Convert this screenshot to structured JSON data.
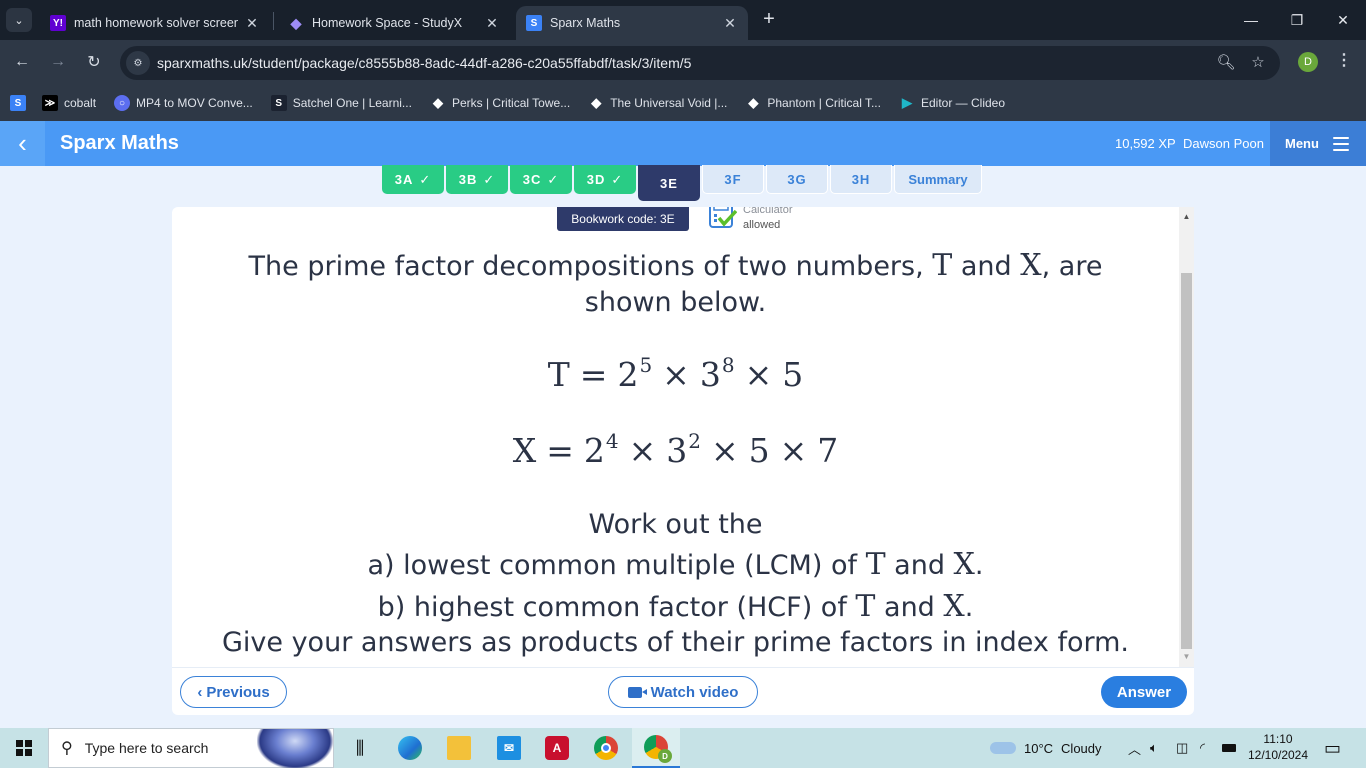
{
  "browser": {
    "tabs": [
      {
        "title": "math homework solver screen s",
        "favicon": "Y!",
        "favicon_color": "#6001d2",
        "active": false
      },
      {
        "title": "Homework Space - StudyX",
        "favicon": "◆",
        "favicon_color": "#7d6df0",
        "active": false
      },
      {
        "title": "Sparx Maths",
        "favicon": "S",
        "favicon_color": "#3b82f6",
        "active": true
      }
    ],
    "new_tab_label": "+",
    "url": "sparxmaths.uk/student/package/c8555b88-8adc-44df-a286-c20a55ffabdf/task/3/item/5",
    "profile_initial": "D",
    "bookmarks": [
      {
        "label": "",
        "icon": "S",
        "color": "#3b82f6"
      },
      {
        "label": "cobalt",
        "icon": "≫",
        "color": "#000000"
      },
      {
        "label": "MP4 to MOV Conve...",
        "icon": "○",
        "color": "#5c6ef0"
      },
      {
        "label": "Satchel One | Learni...",
        "icon": "S",
        "color": "#1b2230"
      },
      {
        "label": "Perks | Critical Towe...",
        "icon": "◆",
        "color": "#ffffff"
      },
      {
        "label": "The Universal Void |...",
        "icon": "◆",
        "color": "#ffffff"
      },
      {
        "label": "Phantom | Critical T...",
        "icon": "◆",
        "color": "#ffffff"
      },
      {
        "label": "Editor — Clideo",
        "icon": "▶",
        "color": "#1fb7c9"
      }
    ]
  },
  "app": {
    "brand": "Sparx Maths",
    "xp": "10,592 XP",
    "user": "Dawson Poon",
    "menu_label": "Menu",
    "task_tabs": [
      {
        "label": "3A",
        "state": "done"
      },
      {
        "label": "3B",
        "state": "done"
      },
      {
        "label": "3C",
        "state": "done"
      },
      {
        "label": "3D",
        "state": "done"
      },
      {
        "label": "3E",
        "state": "current"
      },
      {
        "label": "3F",
        "state": "todo"
      },
      {
        "label": "3G",
        "state": "todo"
      },
      {
        "label": "3H",
        "state": "todo"
      },
      {
        "label": "Summary",
        "state": "todo"
      }
    ],
    "check_glyph": "✓",
    "bookwork_code": "Bookwork code: 3E",
    "calculator_line1": "Calculator",
    "calculator_line2": "allowed",
    "question": {
      "intro_part1": "The prime factor decompositions of two numbers, ",
      "var_t": "T",
      "and": " and ",
      "var_x": "X",
      "intro_part2": ", are",
      "intro_line2": "shown below.",
      "eq_t": {
        "lhs": "T",
        "terms": [
          {
            "base": "2",
            "exp": "5"
          },
          {
            "base": "3",
            "exp": "8"
          },
          {
            "base": "5",
            "exp": ""
          }
        ]
      },
      "eq_x": {
        "lhs": "X",
        "terms": [
          {
            "base": "2",
            "exp": "4"
          },
          {
            "base": "3",
            "exp": "2"
          },
          {
            "base": "5",
            "exp": ""
          },
          {
            "base": "7",
            "exp": ""
          }
        ]
      },
      "work_out": "Work out the",
      "part_a_pre": "a) lowest common multiple (LCM) of ",
      "part_b_pre": "b) highest common factor (HCF) of ",
      "period": ".",
      "instruction": "Give your answers as products of their prime factors in index form."
    },
    "buttons": {
      "previous": "Previous",
      "watch_video": "Watch video",
      "answer": "Answer"
    },
    "colors": {
      "accent": "#4a99f5",
      "done_tab": "#29cc85",
      "current_tab": "#2e3a6a",
      "answer_button": "#2a7ee0"
    }
  },
  "taskbar": {
    "search_placeholder": "Type here to search",
    "weather_temp": "10°C",
    "weather_desc": "Cloudy",
    "time": "11:10",
    "date": "12/10/2024"
  }
}
